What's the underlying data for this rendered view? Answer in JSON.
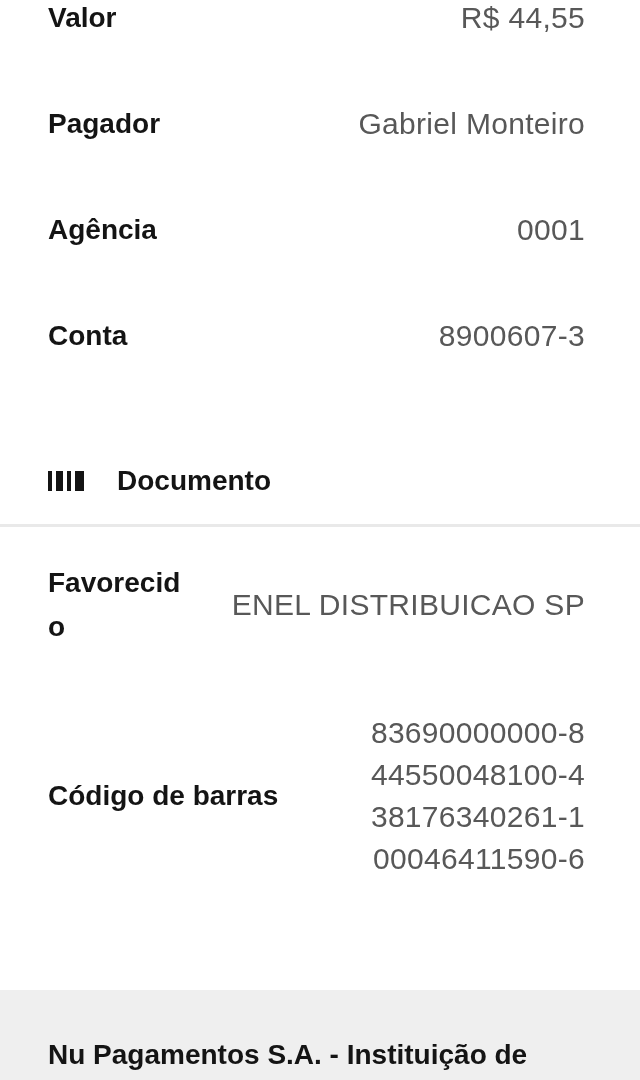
{
  "payment_details": [
    {
      "label": "Valor",
      "value": "R$ 44,55"
    },
    {
      "label": "Pagador",
      "value": "Gabriel Monteiro"
    },
    {
      "label": "Agência",
      "value": "0001"
    },
    {
      "label": "Conta",
      "value": "8900607-3"
    }
  ],
  "document_section": {
    "title": "Documento",
    "rows": [
      {
        "label": "Favorecido",
        "value_lines": [
          "ENEL DISTRIBUICAO SP"
        ]
      },
      {
        "label": "Código de barras",
        "value_lines": [
          "83690000000-8",
          "44550048100-4",
          "38176340261-1",
          "00046411590-6"
        ]
      }
    ]
  },
  "footer": {
    "text": "Nu Pagamentos S.A. - Instituição de"
  }
}
